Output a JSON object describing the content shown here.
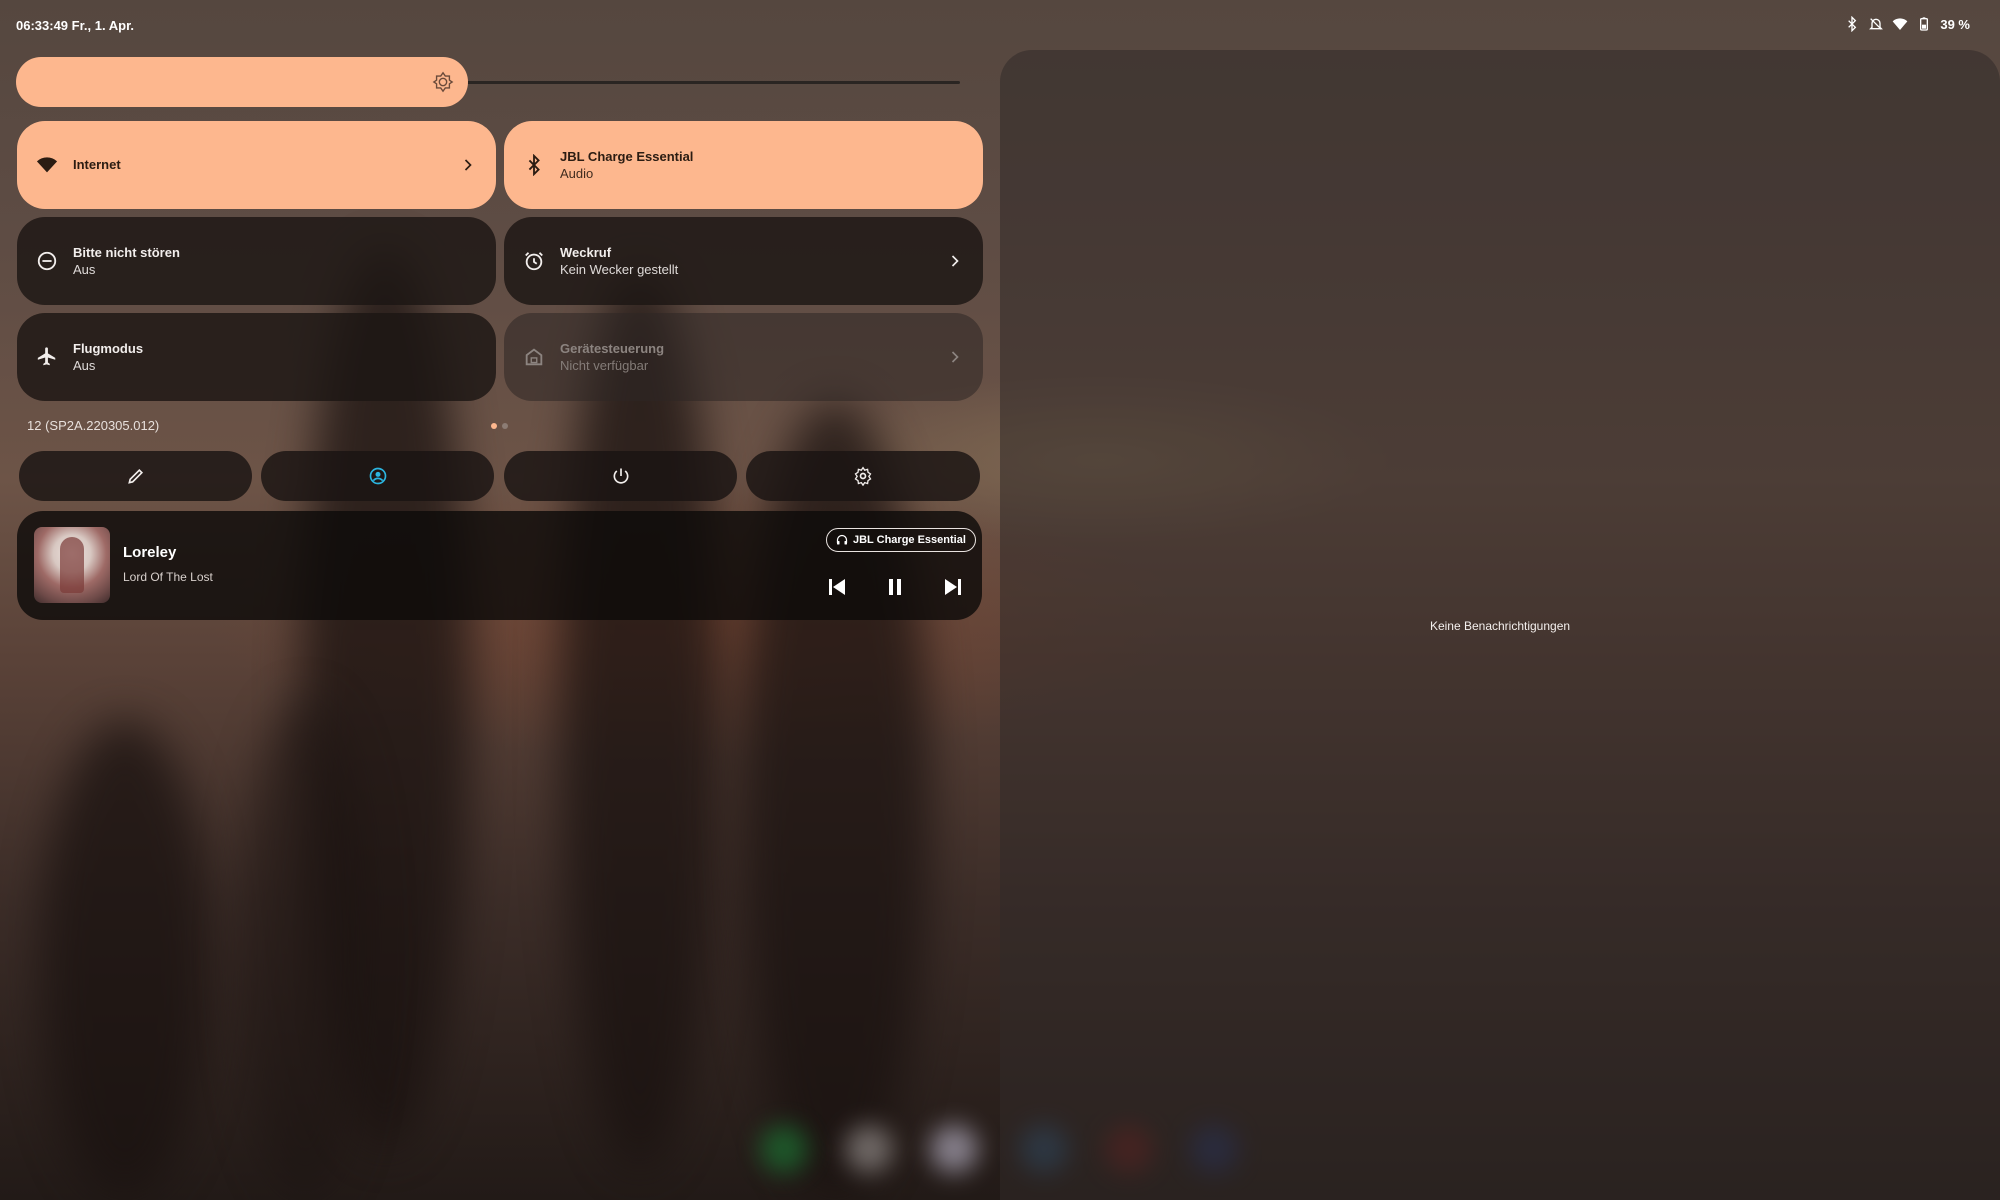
{
  "status_bar": {
    "time_date": "06:33:49 Fr., 1. Apr.",
    "battery": "39 %",
    "icons": [
      "bluetooth-icon",
      "mute-icon",
      "wifi-icon",
      "battery-icon"
    ]
  },
  "brightness": {
    "level": 0.45,
    "icon": "brightness-icon"
  },
  "tiles": [
    {
      "title": "Internet",
      "subtitle": "",
      "state": "on",
      "icon": "wifi-icon",
      "chevron": true
    },
    {
      "title": "JBL Charge Essential",
      "subtitle": "Audio",
      "state": "on",
      "icon": "bluetooth-icon",
      "chevron": false
    },
    {
      "title": "Bitte nicht stören",
      "subtitle": "Aus",
      "state": "off",
      "icon": "do-not-disturb-icon",
      "chevron": false
    },
    {
      "title": "Weckruf",
      "subtitle": "Kein Wecker gestellt",
      "state": "off",
      "icon": "alarm-icon",
      "chevron": true
    },
    {
      "title": "Flugmodus",
      "subtitle": "Aus",
      "state": "off",
      "icon": "airplane-icon",
      "chevron": false
    },
    {
      "title": "Gerätesteuerung",
      "subtitle": "Nicht verfügbar",
      "state": "unavailable",
      "icon": "home-icon",
      "chevron": true
    }
  ],
  "build_number": "12 (SP2A.220305.012)",
  "page_dots": {
    "count": 2,
    "active": 0
  },
  "action_buttons": [
    "edit-icon",
    "user-switch-icon",
    "power-icon",
    "settings-icon"
  ],
  "media": {
    "title": "Loreley",
    "artist": "Lord Of The Lost",
    "output_device": "JBL Charge Essential",
    "controls": [
      "previous-icon",
      "pause-icon",
      "next-icon"
    ]
  },
  "notifications": {
    "empty_text": "Keine Benachrichtigungen"
  },
  "colors": {
    "accent": "#fdb78e",
    "tile_off": "#1c1614",
    "user_icon": "#2bb5e0"
  }
}
